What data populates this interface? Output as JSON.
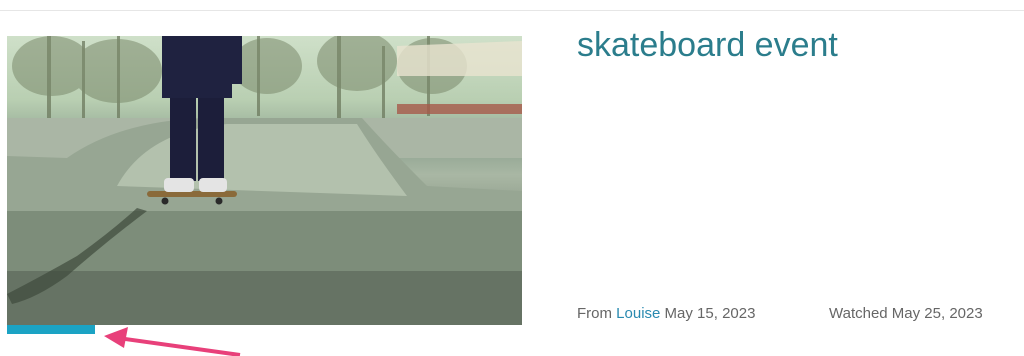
{
  "video": {
    "title": "skateboard event",
    "thumbnail_alt": "skateboarder standing on board at skate park",
    "watch_progress_percent": 17
  },
  "meta": {
    "from_prefix": "From",
    "author": "Louise",
    "posted_date": "May 15, 2023",
    "watched_label": "Watched May 25, 2023"
  },
  "colors": {
    "progress": "#1ba3c4",
    "title": "#2b7d8c",
    "link": "#2a8ab0",
    "annotation_arrow": "#e8407a"
  }
}
